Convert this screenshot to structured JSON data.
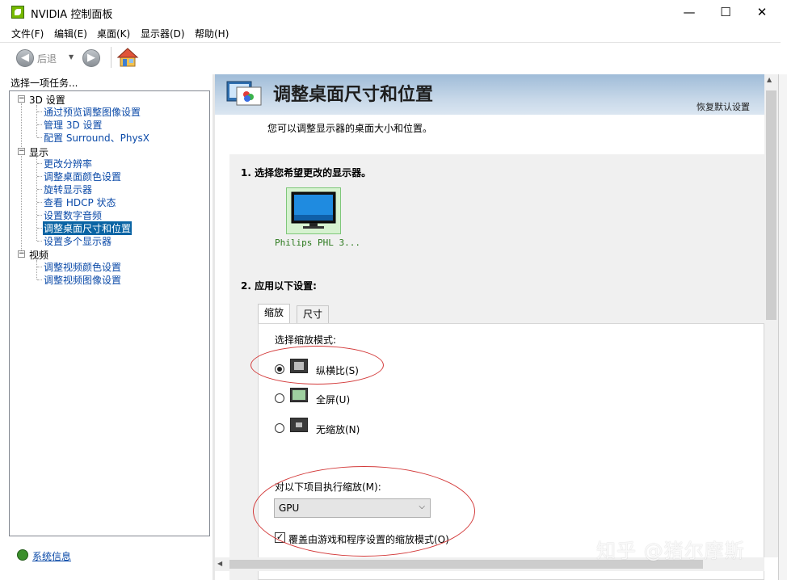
{
  "window": {
    "title": "NVIDIA 控制面板",
    "minimize": "—",
    "maximize": "☐",
    "close": "✕"
  },
  "menu": [
    "文件(F)",
    "编辑(E)",
    "桌面(K)",
    "显示器(D)",
    "帮助(H)"
  ],
  "toolbar": {
    "back_label": "后退",
    "back_arrow": "◀",
    "forward_arrow": "▶",
    "dropdown": "▼"
  },
  "sidebar": {
    "header": "选择一项任务...",
    "groups": [
      {
        "label": "3D 设置",
        "items": [
          "通过预览调整图像设置",
          "管理 3D 设置",
          "配置 Surround、PhysX"
        ]
      },
      {
        "label": "显示",
        "items": [
          "更改分辨率",
          "调整桌面颜色设置",
          "旋转显示器",
          "查看 HDCP 状态",
          "设置数字音频",
          "调整桌面尺寸和位置",
          "设置多个显示器"
        ]
      },
      {
        "label": "视频",
        "items": [
          "调整视频颜色设置",
          "调整视频图像设置"
        ]
      }
    ],
    "expander_symbol": "−",
    "system_info": "系统信息"
  },
  "main": {
    "title": "调整桌面尺寸和位置",
    "restore_defaults": "恢复默认设置",
    "subtitle": "您可以调整显示器的桌面大小和位置。",
    "step1": "1. 选择您希望更改的显示器。",
    "display_name": "Philips PHL 3...",
    "step2": "2. 应用以下设置:",
    "tabs": [
      "缩放",
      "尺寸"
    ],
    "scaling_mode_label": "选择缩放模式:",
    "modes": [
      "纵横比(S)",
      "全屏(U)",
      "无缩放(N)"
    ],
    "selected_mode": "纵横比(S)",
    "perform_scaling_label": "对以下项目执行缩放(M):",
    "perform_scaling_value": "GPU",
    "select_arrow": "⌵",
    "override_label": "覆盖由游戏和程序设置的缩放模式(O)",
    "override_checked": "✓"
  },
  "watermark": "知乎 @猪尔摩斯",
  "colors": {
    "selection": "#0a64a4",
    "link": "#0b4aa8",
    "header_band": "#9fbcd8",
    "annotation": "#d33a3a",
    "nvidia_green": "#76b900"
  }
}
